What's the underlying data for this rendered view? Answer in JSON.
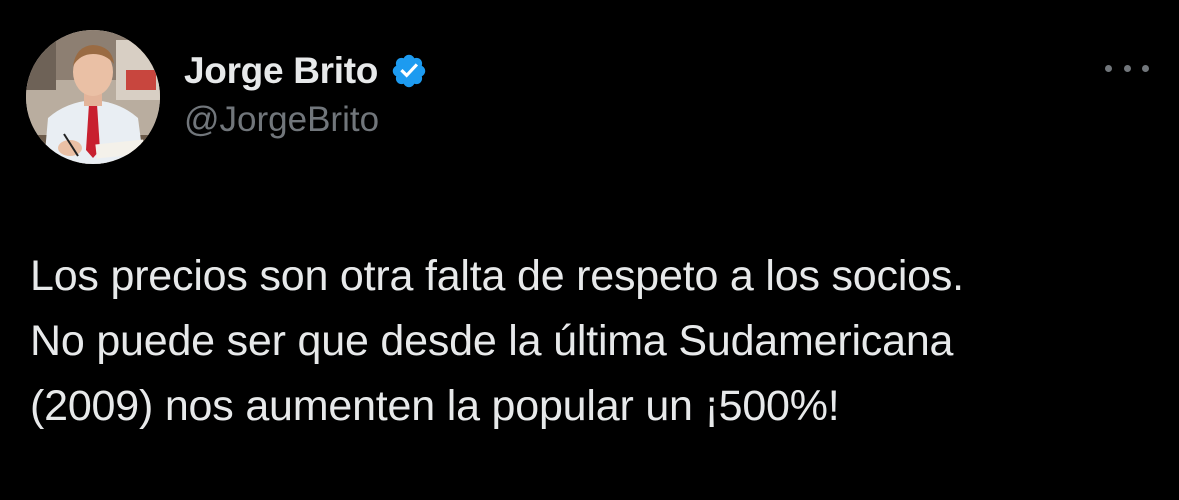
{
  "tweet": {
    "author": {
      "display_name": "Jorge Brito",
      "handle": "@JorgeBrito",
      "verified": true
    },
    "text_lines": [
      "Los precios son otra falta de respeto a los socios.",
      "No puede ser que desde la última Sudamericana",
      "(2009) nos aumenten la popular un ¡500%!"
    ],
    "more_icon": "ellipsis-icon",
    "verified_icon": "verified-badge-icon"
  },
  "colors": {
    "background": "#000000",
    "text_primary": "#e7e9ea",
    "text_secondary": "#71767b",
    "verified_blue": "#1d9bf0"
  }
}
